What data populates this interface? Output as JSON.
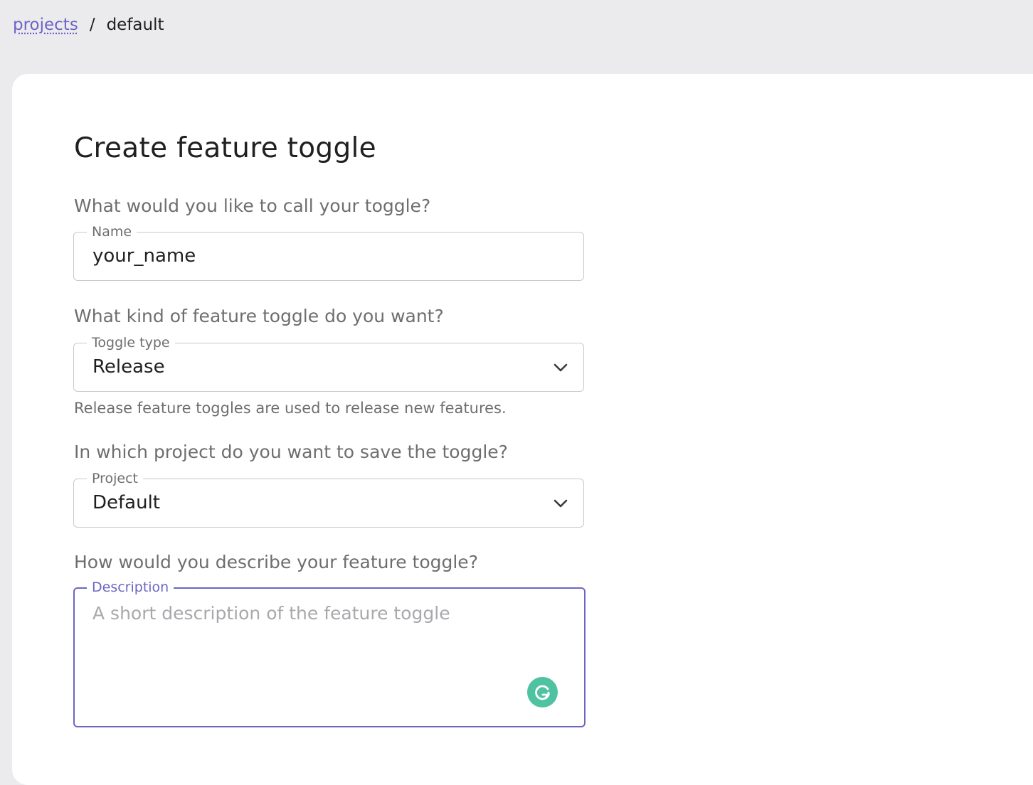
{
  "breadcrumb": {
    "link": "projects",
    "separator": "/",
    "current": "default"
  },
  "form": {
    "title": "Create feature toggle",
    "name_question": "What would you like to call your toggle?",
    "name_label": "Name",
    "name_value": "your_name",
    "type_question": "What kind of feature toggle do you want?",
    "type_label": "Toggle type",
    "type_value": "Release",
    "type_helper": "Release feature toggles are used to release new features.",
    "project_question": "In which project do you want to save the toggle?",
    "project_label": "Project",
    "project_value": "Default",
    "description_question": "How would you describe your feature toggle?",
    "description_label": "Description",
    "description_placeholder": "A short description of the feature toggle"
  },
  "icons": {
    "select_chevron": "chevron-down-icon",
    "grammarly": "grammarly-icon"
  },
  "colors": {
    "accent": "#6c65c5",
    "background": "#ebebee",
    "grammarly": "#4fc3a1"
  }
}
